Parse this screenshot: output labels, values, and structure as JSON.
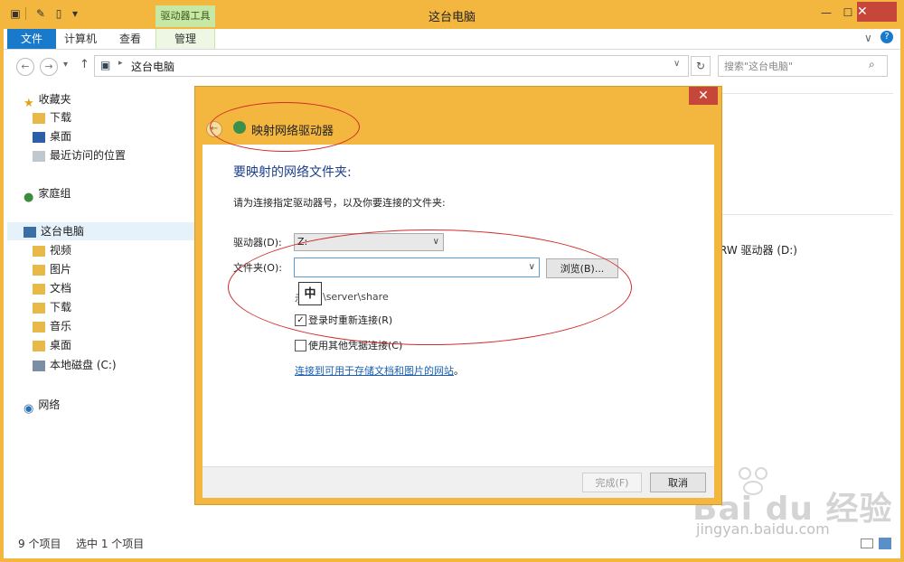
{
  "window": {
    "title": "这台电脑",
    "context_tab": "驱动器工具",
    "ribbon_tabs": [
      "文件",
      "计算机",
      "查看",
      "管理"
    ],
    "controls": {
      "minimize": "—",
      "maximize": "☐",
      "close": "✕"
    }
  },
  "navbar": {
    "back": "←",
    "forward": "→",
    "recent": "▾",
    "up": "↑",
    "address": "这台电脑",
    "search_placeholder": "搜索\"这台电脑\"",
    "search_icon": "magnifier-icon"
  },
  "sidebar": {
    "favorites": {
      "title": "收藏夹",
      "items": [
        "下载",
        "桌面",
        "最近访问的位置"
      ]
    },
    "homegroup": "家庭组",
    "this_pc": {
      "title": "这台电脑",
      "items": [
        "视频",
        "图片",
        "文档",
        "下载",
        "音乐",
        "桌面",
        "本地磁盘 (C:)"
      ]
    },
    "network": "网络"
  },
  "content": {
    "visible_drive": "RW 驱动器 (D:)"
  },
  "status": {
    "items_count": "9 个项目",
    "selected": "选中 1 个项目"
  },
  "dialog": {
    "title": "映射网络驱动器",
    "back": "←",
    "close": "✕",
    "heading": "要映射的网络文件夹:",
    "instruction": "请为连接指定驱动器号，以及你要连接的文件夹:",
    "drive_label": "驱动器(D):",
    "drive_value": "Z:",
    "folder_label": "文件夹(O):",
    "folder_value": "",
    "browse": "浏览(B)...",
    "example_prefix": "示",
    "example_path": "\\server\\share",
    "ime_indicator": "中",
    "reconnect_label": "登录时重新连接(R)",
    "reconnect_checked": true,
    "other_credentials_label": "使用其他凭据连接(C)",
    "other_credentials_checked": false,
    "link_text": "连接到可用于存储文档和图片的网站",
    "link_suffix": "。",
    "finish": "完成(F)",
    "cancel": "取消"
  },
  "watermark": {
    "brand": "Bai du 经验",
    "url": "jingyan.baidu.com"
  },
  "colors": {
    "title_bar": "#f3b63f",
    "file_tab": "#1979ca",
    "context_tab": "#c7e7a4",
    "close": "#c7463a",
    "annotation": "#d12b2b",
    "link": "#1a5fb4"
  }
}
